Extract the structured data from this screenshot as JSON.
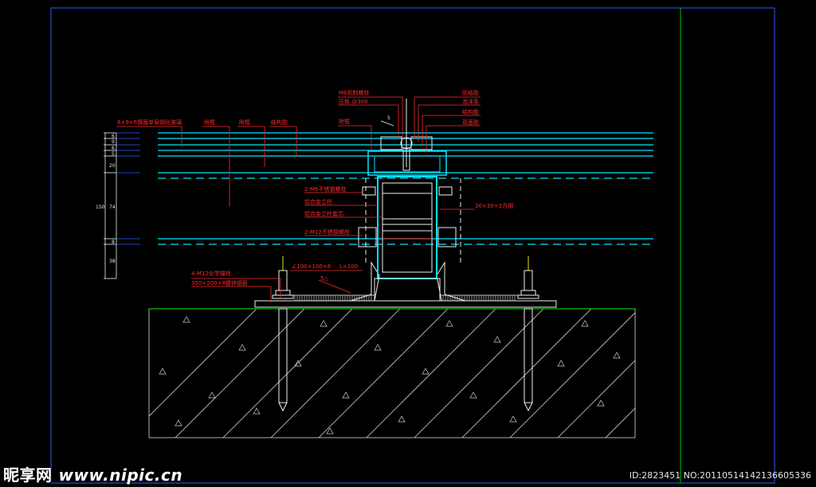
{
  "labels": {
    "bolt_top": "M6机制螺栓",
    "plate_top": "压板 @300",
    "top_right_1": "防结胶",
    "top_right_2": "泡沫条",
    "top_right_3": "结构胶",
    "top_right_4": "双面胶",
    "glass": "6+9+6镀膜单层钢化玻璃",
    "l1": "附框",
    "l2": "附框",
    "l3": "结构胶",
    "subframe": "附框",
    "weld_dim": "5",
    "bolt_m6": "2-M6不锈钢螺栓",
    "alu_column": "铝合金立柱",
    "alu_sleeve": "铝合金立柱套芯",
    "bolt_m12": "2-M12不锈钢螺栓",
    "steel_tube": "30×30×3方钢",
    "angle": "∠100×100×6",
    "angle_len": "L=100",
    "weld_5": "5△",
    "chem_anchor": "4-M12化学锚栓",
    "steel_plate": "350×200×8镀锌钢板"
  },
  "dims": {
    "left_stack": [
      "6",
      "9",
      "6",
      "5",
      "20",
      "74",
      "8",
      "38"
    ],
    "total": "150"
  },
  "watermark": {
    "logo": "昵享网",
    "url": "www.nipic.cn"
  },
  "image_id": "ID:2823451 NO:20110514142136605336",
  "colors": {
    "cyan": "#00e5ff",
    "red": "#ff2a2a",
    "green": "#00c400",
    "white": "#f0f0f0",
    "blue": "#2e5bff",
    "magenta": "#ff3cff",
    "yellow": "#e6e600"
  }
}
